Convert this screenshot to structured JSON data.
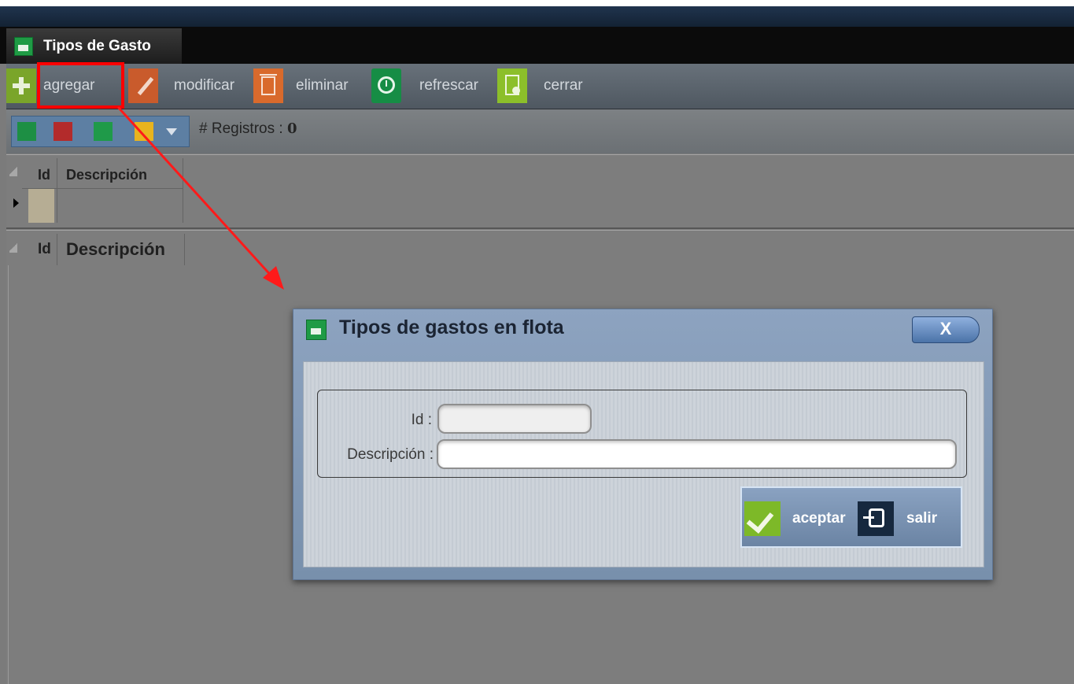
{
  "window": {
    "tab_title": "Tipos de Gasto"
  },
  "toolbar": {
    "items": [
      {
        "label": "agregar",
        "icon": "plus-icon"
      },
      {
        "label": "modificar",
        "icon": "pencil-icon"
      },
      {
        "label": "eliminar",
        "icon": "trash-icon"
      },
      {
        "label": "refrescar",
        "icon": "refresh-icon"
      },
      {
        "label": "cerrar",
        "icon": "close-document-icon"
      }
    ]
  },
  "records": {
    "label": "# Registros :",
    "count": "0"
  },
  "grid_top": {
    "columns": [
      "Id",
      "Descripción"
    ]
  },
  "grid_bottom": {
    "columns": [
      "Id",
      "Descripción"
    ]
  },
  "dialog": {
    "title": "Tipos de gastos en flota",
    "close_label": "X",
    "fields": {
      "id_label": "Id :",
      "id_value": "",
      "desc_label": "Descripción :",
      "desc_value": ""
    },
    "buttons": {
      "accept": "aceptar",
      "exit": "salir"
    }
  },
  "colors": {
    "annotation": "#ff0000",
    "dialog_header": "#8da3c0",
    "toolbar_bg": "#5d666f"
  }
}
